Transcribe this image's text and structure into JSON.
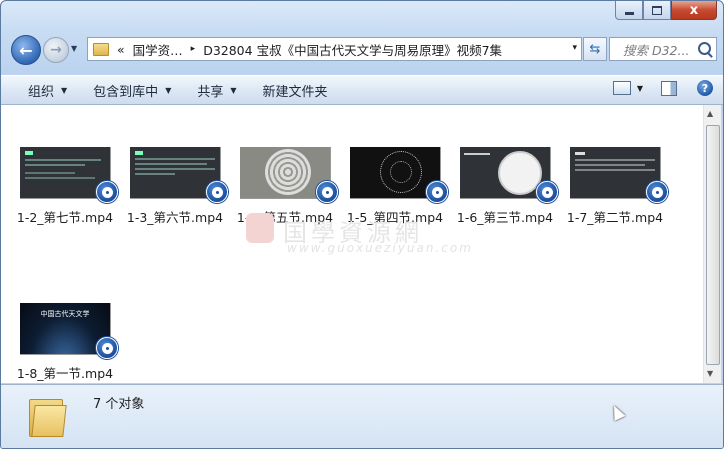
{
  "window": {
    "close_label": "x",
    "address": {
      "history_glyph": "«",
      "crumbs": [
        "国学资…",
        "D32804 宝叔《中国古代天文学与周易原理》视频7集"
      ],
      "separator": "▸",
      "dropdown": "▾"
    },
    "search": {
      "placeholder": "搜索 D32..."
    }
  },
  "toolbar": {
    "organize": "组织",
    "include_library": "包含到库中",
    "share": "共享",
    "new_folder": "新建文件夹",
    "help": "?"
  },
  "files": [
    {
      "name": "1-2_第七节.mp4",
      "thumb": "text"
    },
    {
      "name": "1-3_第六节.mp4",
      "thumb": "text"
    },
    {
      "name": "1-4_第五节.mp4",
      "thumb": "circle-chart"
    },
    {
      "name": "1-5_第四节.mp4",
      "thumb": "star-chart"
    },
    {
      "name": "1-6_第三节.mp4",
      "thumb": "circle-diagram"
    },
    {
      "name": "1-7_第二节.mp4",
      "thumb": "text"
    },
    {
      "name": "1-8_第一节.mp4",
      "thumb": "space",
      "thumb_title": "中国古代天文学"
    }
  ],
  "watermark": {
    "text": "国學資源網",
    "url": "www.guoxueziyuan.com"
  },
  "status": {
    "count": "7 个对象"
  },
  "icons": {
    "back": "back-arrow-icon",
    "forward": "forward-arrow-icon",
    "video_badge": "video-reel-icon",
    "folder": "folder-icon"
  }
}
